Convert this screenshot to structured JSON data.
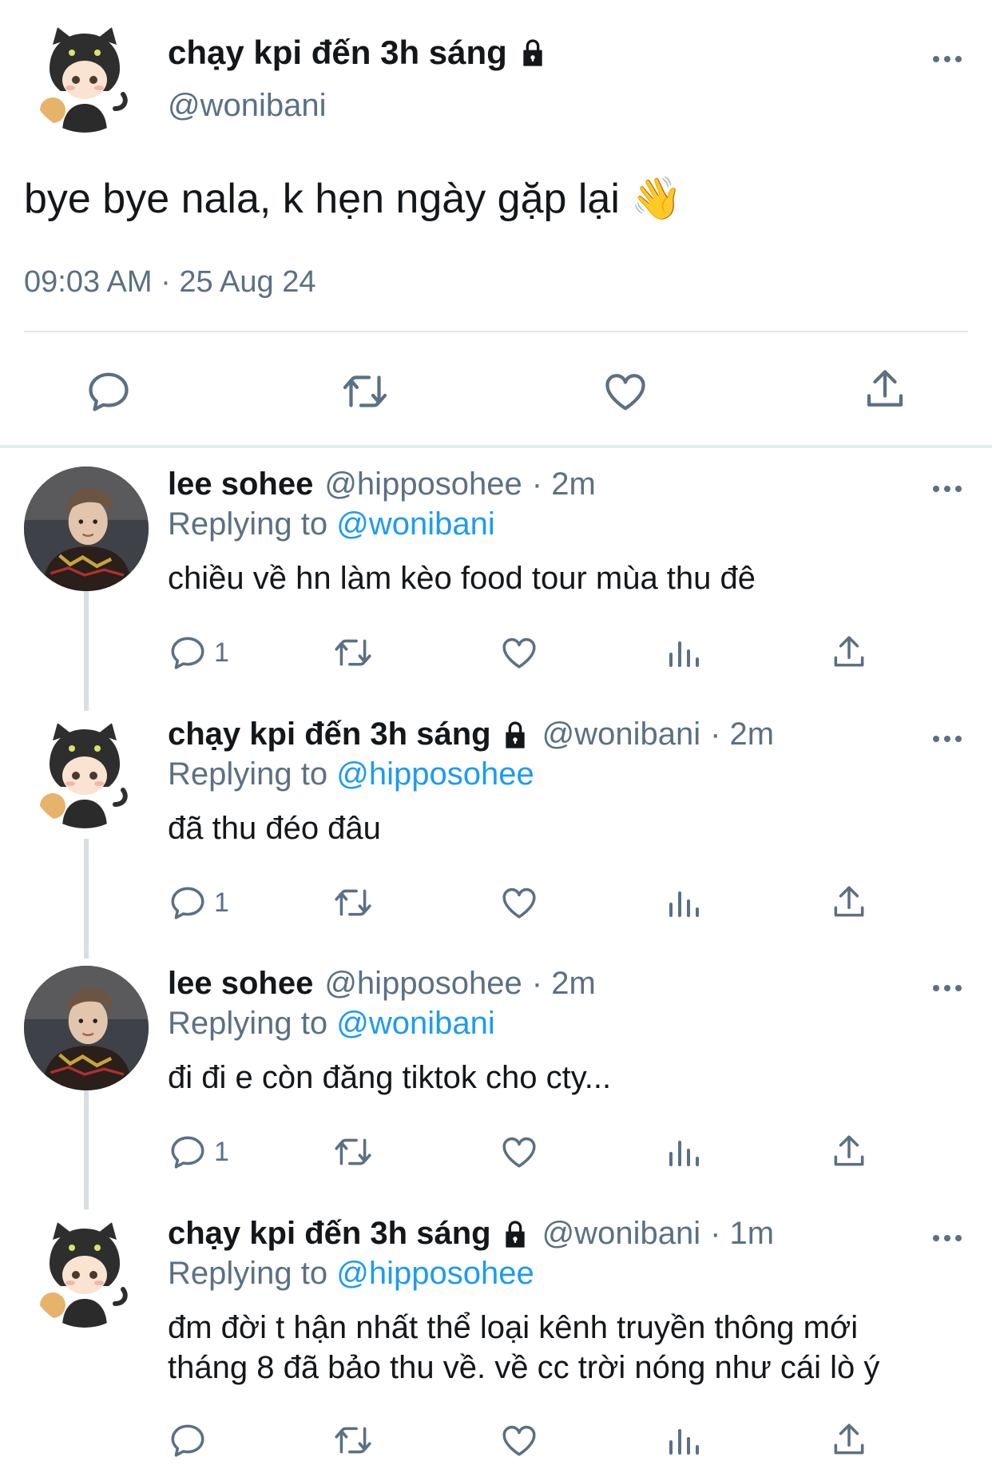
{
  "main_tweet": {
    "name": "chạy kpi đến 3h sáng",
    "handle": "@wonibani",
    "text": "bye bye nala, k hẹn ngày gặp lại",
    "emoji": "👋",
    "timestamp": "09:03 AM · 25 Aug 24",
    "actions": [
      "reply-icon",
      "retweet-icon",
      "like-icon",
      "share-icon"
    ]
  },
  "replies": [
    {
      "name": "lee sohee",
      "handle": "@hipposohee",
      "time": "· 2m",
      "replying_prefix": "Replying to",
      "replying_to": "@wonibani",
      "text": "chiều về hn làm kèo food tour mùa thu đê",
      "reply_count": "1",
      "locked": false
    },
    {
      "name": "chạy kpi đến 3h sáng",
      "handle": "@wonibani",
      "time": "· 2m",
      "replying_prefix": "Replying to",
      "replying_to": "@hipposohee",
      "text": "đã thu đéo đâu",
      "reply_count": "1",
      "locked": true
    },
    {
      "name": "lee sohee",
      "handle": "@hipposohee",
      "time": "· 2m",
      "replying_prefix": "Replying to",
      "replying_to": "@wonibani",
      "text": "đi đi e còn đăng tiktok cho cty...",
      "reply_count": "1",
      "locked": false
    },
    {
      "name": "chạy kpi đến 3h sáng",
      "handle": "@wonibani",
      "time": "· 1m",
      "replying_prefix": "Replying to",
      "replying_to": "@hipposohee",
      "text_line1": "đm đời t hận nhất thể loại kênh truyền thông mới",
      "text_line2": "tháng 8 đã bảo thu về. về cc trời nóng như cái lò ý",
      "reply_count": "",
      "locked": true
    }
  ],
  "colors": {
    "text": "#14171a",
    "secondary": "#5b7083",
    "link": "#1d9bf0",
    "divider": "#e1e8ed"
  }
}
